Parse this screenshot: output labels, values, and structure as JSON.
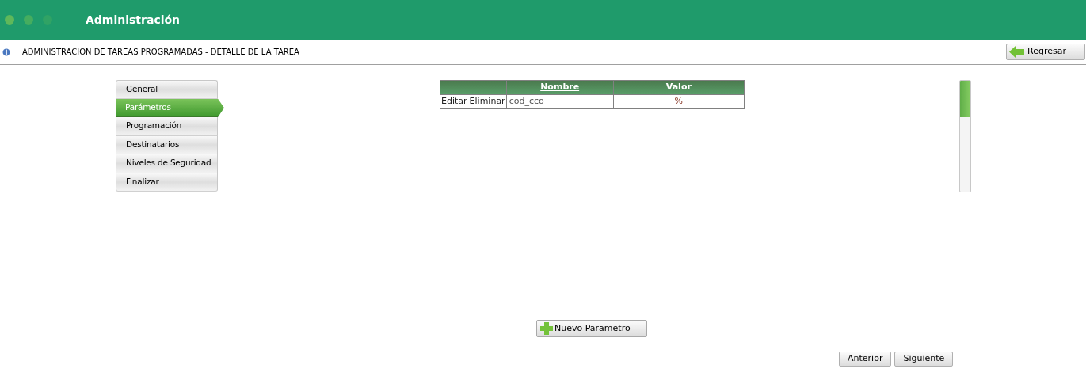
{
  "app_title": "Administración",
  "page_title": "ADMINISTRACION DE TAREAS PROGRAMADAS - DETALLE DE LA TAREA",
  "back_button": "Regresar",
  "steps": [
    {
      "label": "General",
      "selected": false
    },
    {
      "label": "Parámetros",
      "selected": true
    },
    {
      "label": "Programación",
      "selected": false
    },
    {
      "label": "Destinatarios",
      "selected": false
    },
    {
      "label": "Niveles de Seguridad",
      "selected": false
    },
    {
      "label": "Finalizar",
      "selected": false
    }
  ],
  "table": {
    "columns": [
      "Nombre",
      "Valor"
    ],
    "rows": [
      {
        "actions": [
          "Editar",
          "Eliminar"
        ],
        "nombre": "cod_cco",
        "valor": "%"
      }
    ]
  },
  "progress": {
    "level": 0.33
  },
  "new_button": "Nuevo Parametro",
  "nav_buttons": [
    "Anterior",
    "Siguiente"
  ]
}
